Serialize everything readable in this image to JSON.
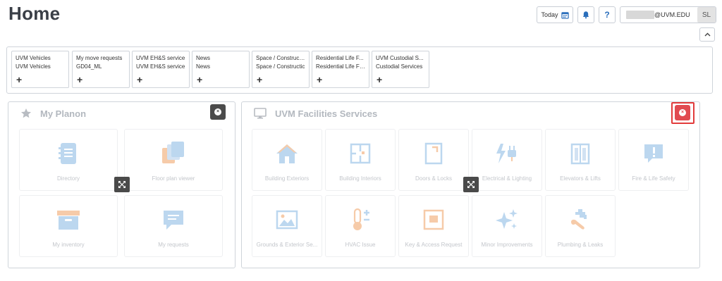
{
  "page": {
    "title": "Home"
  },
  "topbar": {
    "today_label": "Today",
    "email_suffix": "@UVM.EDU",
    "user_initials": "SL"
  },
  "shortcuts": [
    {
      "line1": "UVM Vehicles",
      "line2": "UVM Vehicles"
    },
    {
      "line1": "My move requests",
      "line2": "GD04_ML"
    },
    {
      "line1": "UVM EH&S service",
      "line2": "UVM EH&S service"
    },
    {
      "line1": "News",
      "line2": "News"
    },
    {
      "line1": "Space / Construct...",
      "line2": "Space / Constructic"
    },
    {
      "line1": "Residential Life F...",
      "line2": "Residential Life Fac"
    },
    {
      "line1": "UVM Custodial S...",
      "line2": "Custodial Services"
    }
  ],
  "my_planon": {
    "title": "My Planon",
    "tiles": [
      {
        "label": "Directory",
        "icon": "directory-icon"
      },
      {
        "label": "Floor plan viewer",
        "icon": "floor-plan-icon"
      },
      {
        "label": "My inventory",
        "icon": "inventory-box-icon"
      },
      {
        "label": "My requests",
        "icon": "chat-bubble-icon"
      }
    ]
  },
  "facilities": {
    "title": "UVM Facilities Services",
    "tiles": [
      {
        "label": "Building Exteriors",
        "icon": "house-icon"
      },
      {
        "label": "Building Interiors",
        "icon": "floor-plan-icon"
      },
      {
        "label": "Doors & Locks",
        "icon": "door-icon"
      },
      {
        "label": "Electrical & Lighting",
        "icon": "electric-plug-icon"
      },
      {
        "label": "Elevators & Lifts",
        "icon": "elevator-icon"
      },
      {
        "label": "Fire & Life Safety",
        "icon": "alert-bubble-icon"
      },
      {
        "label": "Grounds & Exterior Se...",
        "icon": "picture-icon"
      },
      {
        "label": "HVAC Issue",
        "icon": "thermometer-icon"
      },
      {
        "label": "Key & Access Request",
        "icon": "key-access-icon"
      },
      {
        "label": "Minor Improvements",
        "icon": "sparkle-icon"
      },
      {
        "label": "Plumbing & Leaks",
        "icon": "faucet-wrench-icon"
      }
    ]
  },
  "colors": {
    "icon_blue": "#bcd7ef",
    "icon_orange": "#f6cba9",
    "close_red": "#e14a50",
    "highlight_red": "#e23b3b"
  }
}
